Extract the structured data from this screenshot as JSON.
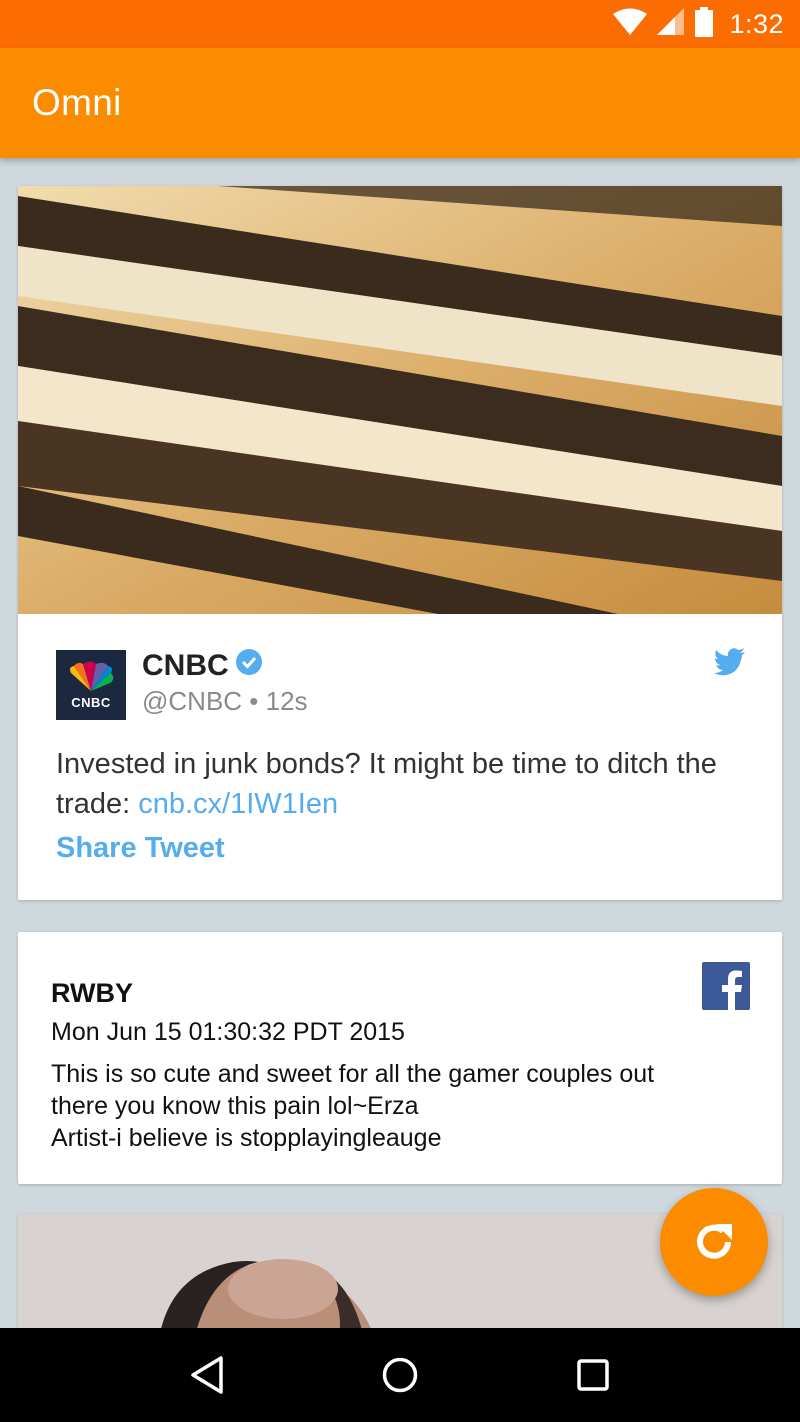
{
  "status_bar": {
    "time": "1:32",
    "icons": [
      "wifi-icon",
      "signal-icon",
      "battery-icon"
    ]
  },
  "app_bar": {
    "title": "Omni"
  },
  "feed": {
    "tweet_card": {
      "image_desc_icon": "savings-bond-image",
      "avatar_text": "CNBC",
      "author": "CNBC",
      "verified": true,
      "handle_time": "@CNBC • 12s",
      "text_plain": "Invested in junk bonds? It might be time to ditch the trade: ",
      "link": "cnb.cx/1IW1Ien",
      "share_label": "Share Tweet",
      "source_icon": "twitter-icon"
    },
    "facebook_card": {
      "title": "RWBY",
      "date": "Mon Jun 15 01:30:32 PDT 2015",
      "text_line1": "This is so cute and sweet for all the gamer couples out",
      "text_line2": "there you know this pain lol~Erza",
      "text_line3": "Artist-i believe is stopplayingleauge",
      "source_icon": "facebook-icon"
    },
    "photo_card": {
      "image_icon": "person-photo"
    }
  },
  "fab": {
    "icon": "refresh-icon"
  },
  "nav_bar": {
    "buttons": [
      "back-icon",
      "home-icon",
      "recents-icon"
    ]
  },
  "colors": {
    "status_bar": "#fb6d00",
    "app_bar": "#fb8c00",
    "background": "#cfd8dc",
    "twitter": "#55acee",
    "facebook": "#3b5998"
  }
}
